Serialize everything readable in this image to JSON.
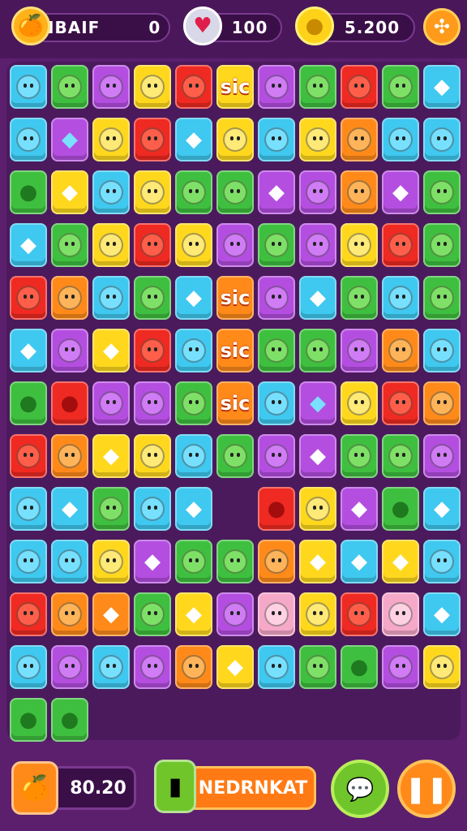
{
  "hud": {
    "player_name": "NBAIF",
    "player_value": "0",
    "lives": "100",
    "coins": "5.200",
    "icons": {
      "player": "fruit-basket-icon",
      "lives": "heart-icon",
      "coins": "gold-nugget-icon",
      "settings": "settings-icon"
    }
  },
  "bottom": {
    "timer": "80.20",
    "action_label": "NEDRNKAT",
    "icons": {
      "timer": "orange-clock-icon",
      "action": "green-box-icon",
      "hint": "chat-bubble-icon",
      "pause": "pause-icon"
    }
  },
  "colors": {
    "background": "#5b1f6e",
    "board": "#4b1a5d",
    "accent_orange": "#ff8a1a",
    "accent_green": "#6fc52a"
  },
  "tile_text": "sic",
  "board": {
    "columns": 11,
    "rows": [
      [
        "cyan:face",
        "green:face",
        "purple:face",
        "yellow:face",
        "red:face",
        [
          "yellow",
          "text"
        ],
        "purple:face",
        "green:face",
        "red:face",
        "green:face",
        "cyan:fruit"
      ],
      [
        "cyan:face",
        "purple:gem",
        "yellow:face",
        "red:face",
        "cyan:fruit",
        [
          "yellow",
          "face"
        ],
        "cyan:face",
        "yellow:face",
        "orange:face",
        "cyan:face",
        "cyan:face"
      ],
      [
        "green:fruit",
        "yellow:fruit",
        "cyan:face",
        "yellow:face",
        "green:face",
        [
          "green",
          "face"
        ],
        "purple:fruit",
        "purple:face",
        "orange:face",
        "purple:fruit",
        "green:face"
      ],
      [
        "cyan:fruit",
        "green:face",
        "yellow:face",
        "red:face",
        "yellow:face",
        [
          "purple",
          "face"
        ],
        "green:face",
        "purple:face",
        "yellow:face",
        "red:face",
        "green:face"
      ],
      [
        "red:face",
        "orange:face",
        "cyan:face",
        "green:face",
        "cyan:fruit",
        [
          "orange",
          "text"
        ],
        "purple:face",
        "cyan:fruit",
        "green:face",
        "cyan:face",
        "green:face"
      ],
      [
        "cyan:fruit",
        "purple:face",
        "yellow:fruit",
        "red:face",
        "cyan:face",
        [
          "orange",
          "text"
        ],
        "green:face",
        "green:face",
        "purple:face",
        "orange:face",
        "cyan:face"
      ],
      [
        "green:fruit",
        "red:fruit",
        "purple:face",
        "purple:face",
        "green:face",
        [
          "orange",
          "text"
        ],
        "cyan:face",
        "purple:gem",
        "yellow:face",
        "red:face",
        "orange:face"
      ],
      [
        "red:face",
        "orange:face",
        "yellow:fruit",
        "yellow:face",
        "cyan:face",
        [
          "green",
          "face"
        ],
        "purple:face",
        "purple:fruit",
        "green:face",
        "green:face",
        "purple:face"
      ],
      [
        "cyan:face",
        "cyan:fruit",
        "green:face",
        "cyan:face",
        "cyan:fruit",
        "empty",
        "red:fruit",
        "yellow:face",
        "purple:fruit",
        "green:fruit",
        "cyan:fruit"
      ],
      [
        "cyan:face",
        "cyan:face",
        "yellow:face",
        "purple:fruit",
        "green:face",
        [
          "green",
          "face"
        ],
        "orange:face",
        "yellow:fruit",
        "cyan:fruit",
        "yellow:fruit",
        "cyan:face"
      ],
      [
        "red:face",
        "orange:face",
        "orange:fruit",
        "green:face",
        "yellow:fruit",
        [
          "purple",
          "face"
        ],
        "pink:face",
        "yellow:face",
        "red:face",
        "pink:face",
        "cyan:fruit"
      ],
      [
        "cyan:face",
        "purple:face",
        "cyan:face",
        "purple:face",
        "orange:face",
        [
          "yellow",
          "fruit"
        ],
        "cyan:face",
        "green:face",
        "green:fruit",
        "purple:face",
        "yellow:face"
      ],
      [
        "green:fruit",
        "green:fruit"
      ]
    ]
  }
}
